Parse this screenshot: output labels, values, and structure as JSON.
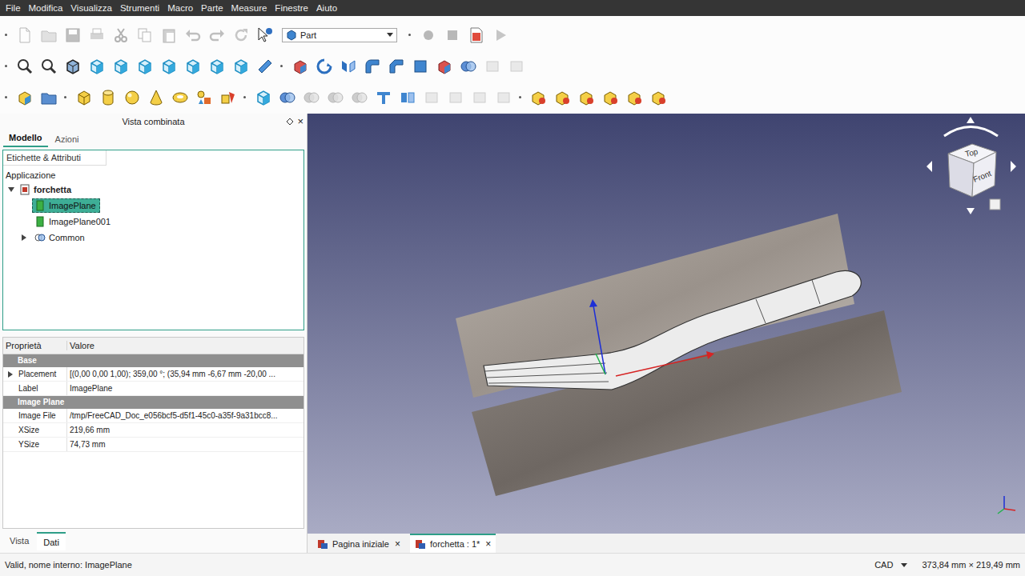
{
  "menu": [
    "File",
    "Modifica",
    "Visualizza",
    "Strumenti",
    "Macro",
    "Parte",
    "Measure",
    "Finestre",
    "Aiuto"
  ],
  "workbench": {
    "label": "Part"
  },
  "toolbars": [
    {
      "groups": [
        [
          {
            "disabled": true
          },
          {
            "disabled": true
          },
          {
            "disabled": true
          },
          {
            "disabled": true
          },
          {
            "disabled": true
          },
          {
            "disabled": true
          },
          {
            "disabled": true
          },
          {
            "disabled": true
          },
          {
            "disabled": true
          },
          {
            "disabled": true
          },
          {
            "disabled": false
          }
        ],
        [
          {
            "disabled": true
          },
          {
            "disabled": true
          },
          {
            "disabled": false
          },
          {
            "disabled": true
          }
        ]
      ]
    },
    {
      "groups": [
        [
          {
            "disabled": false
          },
          {
            "disabled": false
          },
          {
            "disabled": false
          },
          {
            "disabled": false
          },
          {
            "disabled": false
          },
          {
            "disabled": false
          },
          {
            "disabled": false
          },
          {
            "disabled": false
          },
          {
            "disabled": false
          },
          {
            "disabled": false
          },
          {
            "disabled": false
          }
        ],
        [
          {
            "disabled": false
          },
          {
            "disabled": false
          },
          {
            "disabled": false
          },
          {
            "disabled": false
          },
          {
            "disabled": false
          },
          {
            "disabled": false
          },
          {
            "disabled": false
          },
          {
            "disabled": false
          },
          {
            "disabled": true
          },
          {
            "disabled": true
          }
        ]
      ]
    },
    {
      "groups": [
        [
          {
            "disabled": false
          },
          {
            "disabled": false
          }
        ],
        [
          {
            "disabled": false
          },
          {
            "disabled": false
          },
          {
            "disabled": false
          },
          {
            "disabled": false
          },
          {
            "disabled": false
          },
          {
            "disabled": false
          },
          {
            "disabled": false
          }
        ],
        [
          {
            "disabled": false
          },
          {
            "disabled": false
          },
          {
            "disabled": true
          },
          {
            "disabled": true
          },
          {
            "disabled": true
          },
          {
            "disabled": false
          },
          {
            "disabled": false
          },
          {
            "disabled": true
          },
          {
            "disabled": true
          },
          {
            "disabled": true
          },
          {
            "disabled": true
          }
        ],
        [
          {
            "disabled": false
          },
          {
            "disabled": false
          },
          {
            "disabled": false
          },
          {
            "disabled": false
          },
          {
            "disabled": false
          },
          {
            "disabled": false
          }
        ]
      ]
    }
  ],
  "panel": {
    "title": "Vista combinata",
    "close": "×",
    "tabs": [
      {
        "label": "Modello",
        "selected": true
      },
      {
        "label": "Azioni",
        "selected": false
      }
    ],
    "bottom_tabs": [
      {
        "label": "Vista",
        "selected": false
      },
      {
        "label": "Dati",
        "selected": true
      }
    ]
  },
  "tree": {
    "header": "Etichette & Attributi",
    "root": "Applicazione",
    "items": [
      {
        "label": "forchetta",
        "kind": "document",
        "expandable": true,
        "expanded": true,
        "selected": false,
        "children": [
          {
            "label": "ImagePlane",
            "kind": "image",
            "expandable": false,
            "expanded": false,
            "selected": true
          },
          {
            "label": "ImagePlane001",
            "kind": "image",
            "expandable": false,
            "expanded": false,
            "selected": false
          },
          {
            "label": "Common",
            "kind": "boolean",
            "expandable": true,
            "expanded": false,
            "selected": false
          }
        ]
      }
    ]
  },
  "properties": {
    "columns": [
      "Proprietà",
      "Valore"
    ],
    "groups": [
      {
        "name": "Base",
        "rows": [
          {
            "name": "Placement",
            "value": "[(0,00 0,00 1,00); 359,00 °; (35,94 mm -6,67 mm -20,00 ...",
            "expandable": true,
            "expanded": false
          },
          {
            "name": "Label",
            "value": "ImagePlane",
            "expandable": false,
            "expanded": false
          }
        ]
      },
      {
        "name": "Image Plane",
        "rows": [
          {
            "name": "Image File",
            "value": "/tmp/FreeCAD_Doc_e056bcf5-d5f1-45c0-a35f-9a31bcc8...",
            "expandable": false,
            "expanded": false
          },
          {
            "name": "XSize",
            "value": "219,66 mm",
            "expandable": false,
            "expanded": false
          },
          {
            "name": "YSize",
            "value": "74,73 mm",
            "expandable": false,
            "expanded": false
          }
        ]
      }
    ]
  },
  "viewport": {
    "navcube": [
      "Top",
      "Front"
    ]
  },
  "doc_tabs": [
    {
      "label": "Pagina iniziale",
      "close": "×",
      "selected": false
    },
    {
      "label": "forchetta : 1*",
      "close": "×",
      "selected": true
    }
  ],
  "status": {
    "message": "Valid, nome interno: ImagePlane",
    "nav_style": "CAD",
    "dimensions": "373,84 mm × 219,49 mm"
  }
}
